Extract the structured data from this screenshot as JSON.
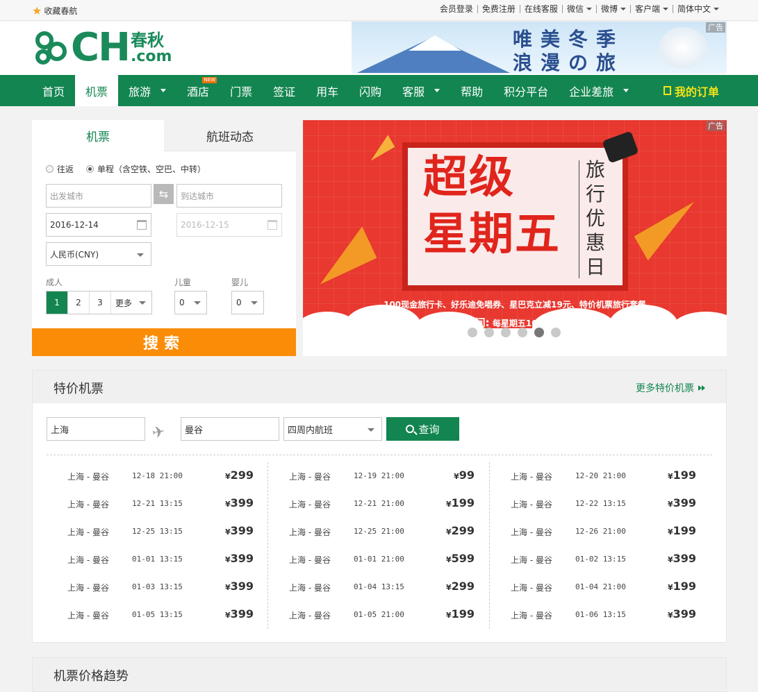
{
  "topbar": {
    "favorite": "收藏春航",
    "links": [
      {
        "label": "会员登录",
        "dropdown": false
      },
      {
        "label": "免费注册",
        "dropdown": false
      },
      {
        "label": "在线客服",
        "dropdown": false
      },
      {
        "label": "微信",
        "dropdown": true
      },
      {
        "label": "微博",
        "dropdown": true
      },
      {
        "label": "客户端",
        "dropdown": true
      },
      {
        "label": "简体中文",
        "dropdown": true
      }
    ]
  },
  "header": {
    "logo_main": "CH",
    "logo_cn": "春秋",
    "logo_com": ".com",
    "ad_tag": "广告",
    "banner_line1": "唯美冬季",
    "banner_line2": "浪漫の旅"
  },
  "nav": {
    "items": [
      {
        "label": "首页",
        "active": false,
        "dropdown": false,
        "badge": ""
      },
      {
        "label": "机票",
        "active": true,
        "dropdown": false,
        "badge": ""
      },
      {
        "label": "旅游",
        "active": false,
        "dropdown": true,
        "badge": ""
      },
      {
        "label": "酒店",
        "active": false,
        "dropdown": false,
        "badge": "NEW"
      },
      {
        "label": "门票",
        "active": false,
        "dropdown": false,
        "badge": ""
      },
      {
        "label": "签证",
        "active": false,
        "dropdown": false,
        "badge": ""
      },
      {
        "label": "用车",
        "active": false,
        "dropdown": false,
        "badge": ""
      },
      {
        "label": "闪购",
        "active": false,
        "dropdown": false,
        "badge": ""
      },
      {
        "label": "客服",
        "active": false,
        "dropdown": true,
        "badge": ""
      },
      {
        "label": "帮助",
        "active": false,
        "dropdown": false,
        "badge": ""
      },
      {
        "label": "积分平台",
        "active": false,
        "dropdown": false,
        "badge": ""
      },
      {
        "label": "企业差旅",
        "active": false,
        "dropdown": true,
        "badge": ""
      }
    ],
    "my_orders": "我的订单"
  },
  "search": {
    "tab_flights": "机票",
    "tab_status": "航班动态",
    "radio_roundtrip": "往返",
    "radio_oneway": "单程（含空铁、空巴、中转）",
    "from_placeholder": "出发城市",
    "to_placeholder": "到达城市",
    "depart_date": "2016-12-14",
    "return_date": "2016-12-15",
    "currency": "人民币(CNY)",
    "adult_label": "成人",
    "child_label": "儿童",
    "infant_label": "婴儿",
    "adult_options": [
      "1",
      "2",
      "3"
    ],
    "adult_more": "更多",
    "child_value": "0",
    "infant_value": "0",
    "search_button": "搜索"
  },
  "promo": {
    "ad_tag": "广告",
    "big_line1": "超级",
    "big_line2": "星期五",
    "vertical_text": "旅行优惠日",
    "subtitle": "100现金旅行卡、好乐迪免唱券、星巴克立减19元、特价机票旅行套餐",
    "time_label": "活动时间:",
    "time_value": "每星期五10:00~22:00",
    "slides": 6,
    "active_slide": 5
  },
  "specials": {
    "title": "特价机票",
    "more": "更多特价机票",
    "from": "上海",
    "to": "曼谷",
    "range": "四周内航班",
    "query_button": "查询",
    "columns": [
      [
        {
          "route": "上海 - 曼谷",
          "date": "12-18 21:00",
          "price": "299"
        },
        {
          "route": "上海 - 曼谷",
          "date": "12-21 13:15",
          "price": "399"
        },
        {
          "route": "上海 - 曼谷",
          "date": "12-25 13:15",
          "price": "399"
        },
        {
          "route": "上海 - 曼谷",
          "date": "01-01 13:15",
          "price": "399"
        },
        {
          "route": "上海 - 曼谷",
          "date": "01-03 13:15",
          "price": "399"
        },
        {
          "route": "上海 - 曼谷",
          "date": "01-05 13:15",
          "price": "399"
        }
      ],
      [
        {
          "route": "上海 - 曼谷",
          "date": "12-19 21:00",
          "price": "99"
        },
        {
          "route": "上海 - 曼谷",
          "date": "12-21 21:00",
          "price": "199"
        },
        {
          "route": "上海 - 曼谷",
          "date": "12-25 21:00",
          "price": "299"
        },
        {
          "route": "上海 - 曼谷",
          "date": "01-01 21:00",
          "price": "599"
        },
        {
          "route": "上海 - 曼谷",
          "date": "01-04 13:15",
          "price": "299"
        },
        {
          "route": "上海 - 曼谷",
          "date": "01-05 21:00",
          "price": "199"
        }
      ],
      [
        {
          "route": "上海 - 曼谷",
          "date": "12-20 21:00",
          "price": "199"
        },
        {
          "route": "上海 - 曼谷",
          "date": "12-22 13:15",
          "price": "399"
        },
        {
          "route": "上海 - 曼谷",
          "date": "12-26 21:00",
          "price": "199"
        },
        {
          "route": "上海 - 曼谷",
          "date": "01-02 13:15",
          "price": "399"
        },
        {
          "route": "上海 - 曼谷",
          "date": "01-04 21:00",
          "price": "199"
        },
        {
          "route": "上海 - 曼谷",
          "date": "01-06 13:15",
          "price": "399"
        }
      ]
    ],
    "currency_symbol": "¥"
  },
  "trend": {
    "title": "机票价格趋势"
  },
  "colors": {
    "brand_green": "#128550",
    "search_orange": "#fb8c07",
    "order_yellow": "#f5e218"
  }
}
